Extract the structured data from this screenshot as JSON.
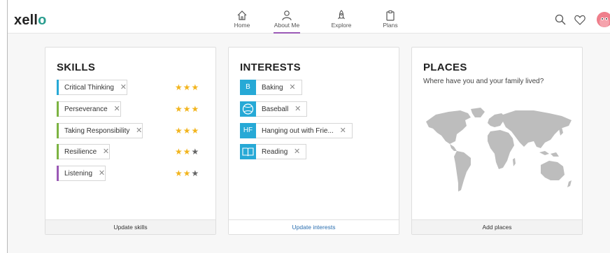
{
  "app": {
    "logo": "xello",
    "nav": [
      {
        "label": "Home"
      },
      {
        "label": "About Me"
      },
      {
        "label": "Explore"
      },
      {
        "label": "Plans"
      }
    ],
    "active_nav": "About Me",
    "accent_color": "#9b59b6"
  },
  "skills": {
    "title": "SKILLS",
    "items": [
      {
        "label": "Critical Thinking",
        "stars": 3,
        "color": "#27a9d6"
      },
      {
        "label": "Perseverance",
        "stars": 3,
        "color": "#7cb342"
      },
      {
        "label": "Taking Responsibility",
        "stars": 3,
        "color": "#7cb342"
      },
      {
        "label": "Resilience",
        "stars": 2,
        "color": "#7cb342"
      },
      {
        "label": "Listening",
        "stars": 2,
        "color": "#9b59b6"
      }
    ],
    "max_stars": 3,
    "footer": "Update skills"
  },
  "interests": {
    "title": "INTERESTS",
    "items": [
      {
        "badge": "B",
        "label": "Baking"
      },
      {
        "badge": "",
        "label": "Baseball",
        "icon": "baseball-icon"
      },
      {
        "badge": "HF",
        "label": "Hanging out with Frie..."
      },
      {
        "badge": "",
        "label": "Reading",
        "icon": "book-icon"
      }
    ],
    "footer": "Update interests"
  },
  "places": {
    "title": "PLACES",
    "subtitle": "Where have you and your family lived?",
    "footer": "Add places"
  },
  "remove_glyph": "✕",
  "star_glyph": "★"
}
